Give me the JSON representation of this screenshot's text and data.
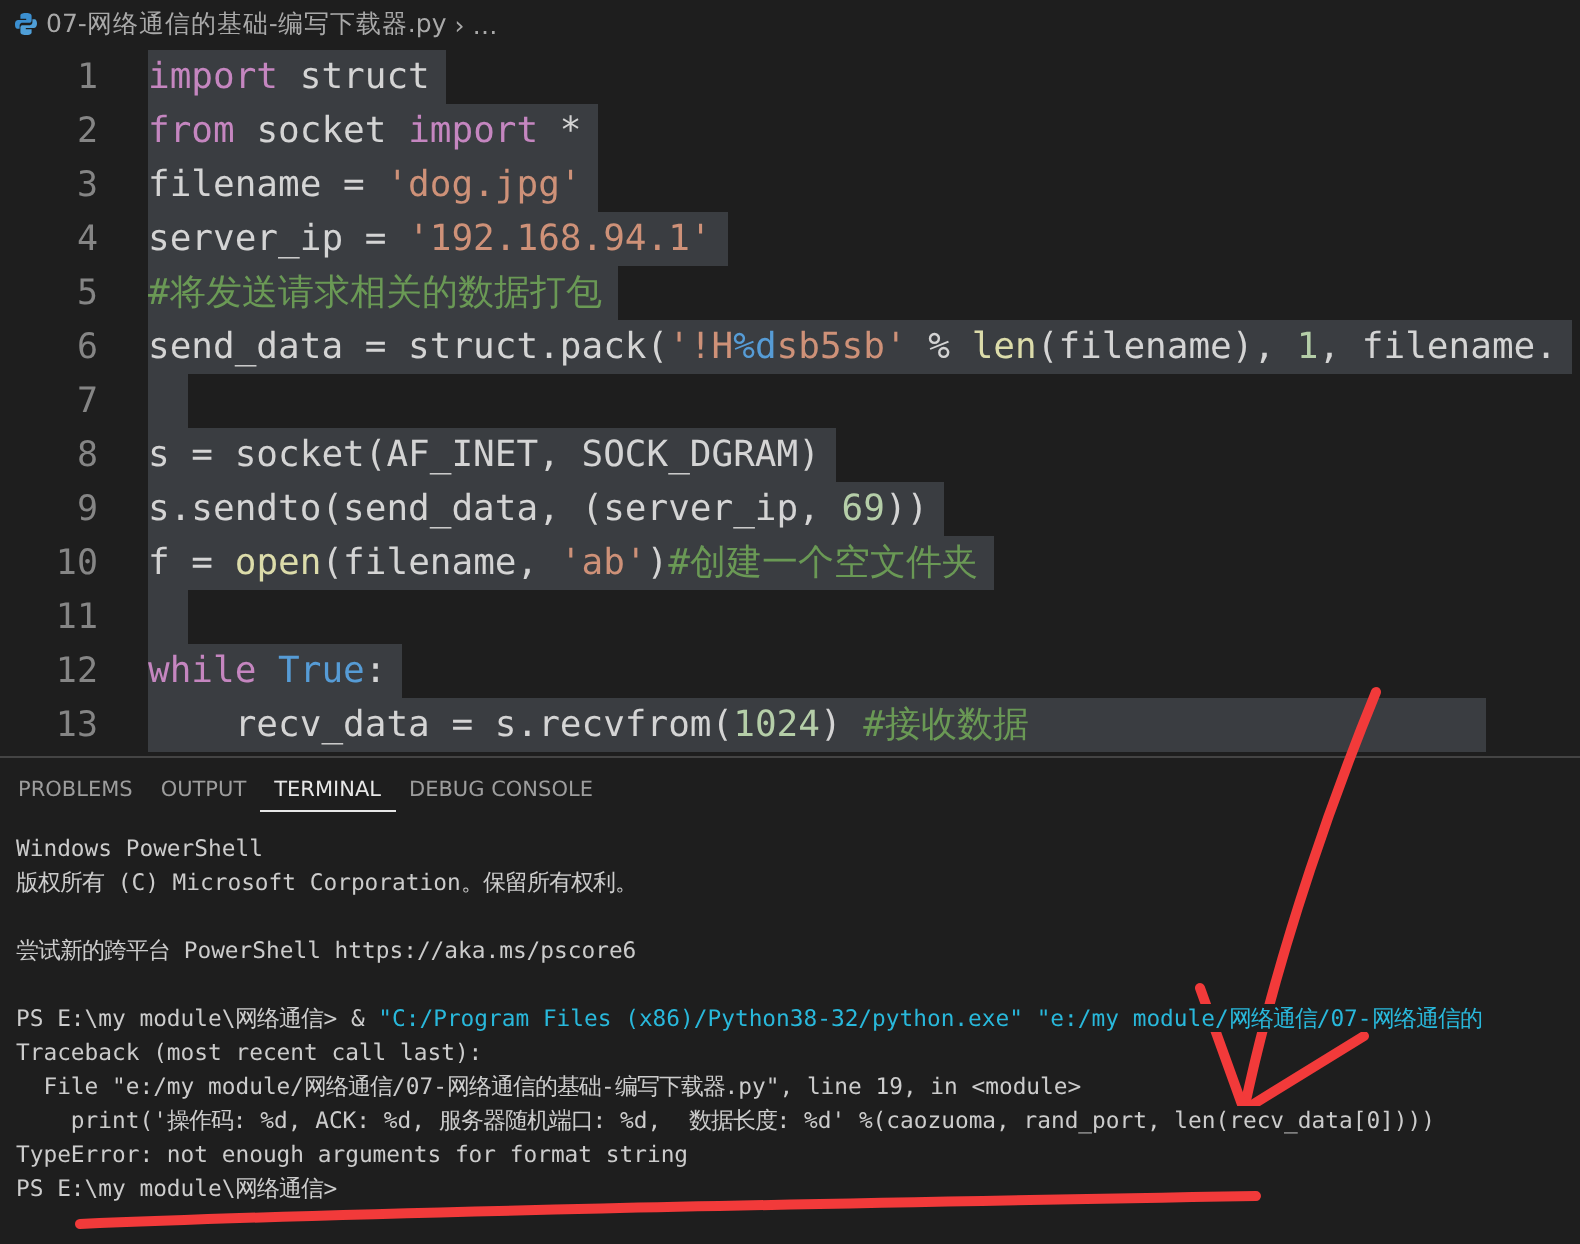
{
  "breadcrumb": {
    "file": "07-网络通信的基础-编写下载器.py",
    "separator": "›",
    "more": "…"
  },
  "editor": {
    "lines": [
      {
        "number": "1",
        "selected": true,
        "tokens": [
          {
            "kind": "keyword",
            "text": "import"
          },
          {
            "kind": "plain",
            "text": " struct"
          }
        ]
      },
      {
        "number": "2",
        "selected": true,
        "tokens": [
          {
            "kind": "keyword",
            "text": "from"
          },
          {
            "kind": "plain",
            "text": " socket "
          },
          {
            "kind": "keyword",
            "text": "import"
          },
          {
            "kind": "plain",
            "text": " *"
          }
        ]
      },
      {
        "number": "3",
        "selected": true,
        "tokens": [
          {
            "kind": "plain",
            "text": "filename = "
          },
          {
            "kind": "string",
            "text": "'dog.jpg'"
          }
        ]
      },
      {
        "number": "4",
        "selected": true,
        "tokens": [
          {
            "kind": "plain",
            "text": "server_ip = "
          },
          {
            "kind": "string",
            "text": "'192.168.94.1'"
          }
        ]
      },
      {
        "number": "5",
        "selected": true,
        "tokens": [
          {
            "kind": "comment",
            "text": "#将发送请求相关的数据打包"
          }
        ]
      },
      {
        "number": "6",
        "selected": true,
        "tokens": [
          {
            "kind": "plain",
            "text": "send_data = struct.pack("
          },
          {
            "kind": "string",
            "text": "'!H"
          },
          {
            "kind": "format",
            "text": "%d"
          },
          {
            "kind": "string",
            "text": "sb5sb'"
          },
          {
            "kind": "plain",
            "text": " % "
          },
          {
            "kind": "function",
            "text": "len"
          },
          {
            "kind": "plain",
            "text": "(filename), "
          },
          {
            "kind": "number",
            "text": "1"
          },
          {
            "kind": "plain",
            "text": ", filename."
          }
        ]
      },
      {
        "number": "7",
        "selected": true
      },
      {
        "number": "8",
        "selected": true,
        "tokens": [
          {
            "kind": "plain",
            "text": "s = socket(AF_INET, SOCK_DGRAM)"
          }
        ]
      },
      {
        "number": "9",
        "selected": true,
        "tokens": [
          {
            "kind": "plain",
            "text": "s.sendto(send_data, (server_ip, "
          },
          {
            "kind": "number",
            "text": "69"
          },
          {
            "kind": "plain",
            "text": "))"
          }
        ]
      },
      {
        "number": "10",
        "selected": true,
        "tokens": [
          {
            "kind": "plain",
            "text": "f = "
          },
          {
            "kind": "function",
            "text": "open"
          },
          {
            "kind": "plain",
            "text": "(filename, "
          },
          {
            "kind": "string",
            "text": "'ab'"
          },
          {
            "kind": "plain",
            "text": ")"
          },
          {
            "kind": "comment",
            "text": "#创建一个空文件夹"
          }
        ]
      },
      {
        "number": "11",
        "selected": true
      },
      {
        "number": "12",
        "selected": true,
        "tokens": [
          {
            "kind": "keyword",
            "text": "while "
          },
          {
            "kind": "constant",
            "text": "True"
          },
          {
            "kind": "plain",
            "text": ":"
          }
        ]
      },
      {
        "number": "13",
        "selected": true,
        "tokens": [
          {
            "kind": "plain",
            "text": "    recv_data = s.recvfrom("
          },
          {
            "kind": "number",
            "text": "1024"
          },
          {
            "kind": "plain",
            "text": ") "
          },
          {
            "kind": "comment",
            "text": "#接收数据"
          }
        ]
      }
    ]
  },
  "panel": {
    "tabs": [
      {
        "label": "PROBLEMS",
        "selected": false
      },
      {
        "label": "OUTPUT",
        "selected": false
      },
      {
        "label": "TERMINAL",
        "selected": true
      },
      {
        "label": "DEBUG CONSOLE",
        "selected": false
      }
    ],
    "terminal": [
      {
        "kind": "text",
        "segments": [
          {
            "kind": "plain",
            "text": "Windows PowerShell"
          }
        ]
      },
      {
        "kind": "text",
        "segments": [
          {
            "kind": "plain",
            "text": "版权所有 (C) Microsoft Corporation。保留所有权利。"
          }
        ]
      },
      {
        "kind": "blank"
      },
      {
        "kind": "text",
        "segments": [
          {
            "kind": "plain",
            "text": "尝试新的跨平台 PowerShell https://aka.ms/pscore6"
          }
        ]
      },
      {
        "kind": "blank"
      },
      {
        "kind": "text",
        "segments": [
          {
            "kind": "plain",
            "text": "PS E:\\my module\\网络通信> & "
          },
          {
            "kind": "string",
            "text": "\"C:/Program Files (x86)/Python38-32/python.exe\" \"e:/my module/网络通信/07-网络通信的"
          }
        ]
      },
      {
        "kind": "text",
        "segments": [
          {
            "kind": "plain",
            "text": "Traceback (most recent call last):"
          }
        ]
      },
      {
        "kind": "text",
        "segments": [
          {
            "kind": "plain",
            "text": "  File \"e:/my module/网络通信/07-网络通信的基础-编写下载器.py\", line 19, in <module>"
          }
        ]
      },
      {
        "kind": "text",
        "segments": [
          {
            "kind": "plain",
            "text": "    print('操作码: %d, ACK: %d, 服务器随机端口: %d,  数据长度: %d' %(caozuoma, rand_port, len(recv_data[0])))"
          }
        ]
      },
      {
        "kind": "text",
        "segments": [
          {
            "kind": "plain",
            "text": "TypeError: not enough arguments for format string"
          }
        ]
      },
      {
        "kind": "text",
        "segments": [
          {
            "kind": "plain",
            "text": "PS E:\\my module\\网络通信>"
          }
        ]
      }
    ]
  }
}
